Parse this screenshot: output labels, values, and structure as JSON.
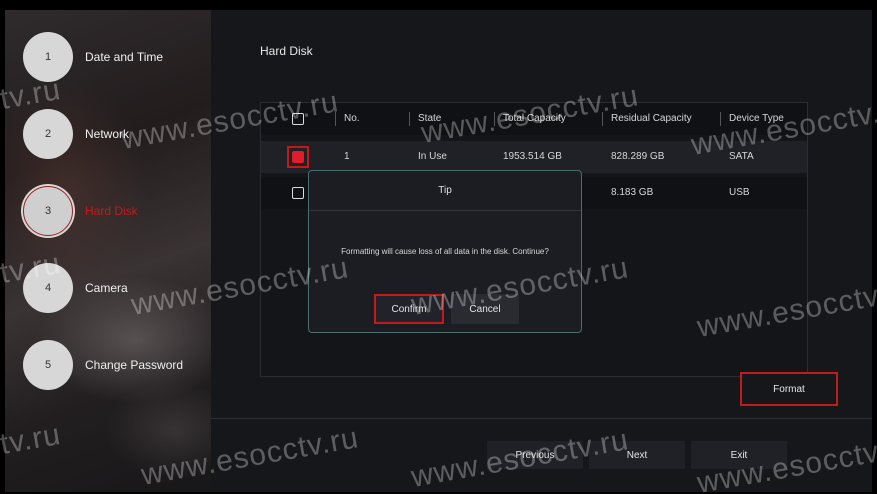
{
  "wizard": {
    "steps": [
      {
        "num": "1",
        "label": "Date and Time"
      },
      {
        "num": "2",
        "label": "Network"
      },
      {
        "num": "3",
        "label": "Hard Disk"
      },
      {
        "num": "4",
        "label": "Camera"
      },
      {
        "num": "5",
        "label": "Change Password"
      }
    ],
    "active_step": 3
  },
  "section_title": "Hard Disk",
  "table": {
    "columns": [
      "No.",
      "State",
      "Total Capacity",
      "Residual Capacity",
      "Device Type"
    ],
    "rows": [
      {
        "no": "1",
        "state": "In Use",
        "total": "1953.514 GB",
        "residual": "828.289 GB",
        "type": "SATA",
        "checked": true
      },
      {
        "no": "",
        "state": "",
        "total": "",
        "residual": "8.183 GB",
        "type": "USB",
        "checked": false
      }
    ]
  },
  "dialog": {
    "title": "Tip",
    "message": "Formatting will cause loss of all data in the disk. Continue?",
    "confirm_label": "Confirm",
    "cancel_label": "Cancel"
  },
  "buttons": {
    "format": "Format",
    "previous": "Previous",
    "next": "Next",
    "exit": "Exit"
  },
  "watermark": {
    "domain": "www.esocctv.ru",
    "fragment": "tv.ru"
  },
  "colors": {
    "accent_red": "#c21b1b",
    "checkbox_red": "#e01d2a",
    "dialog_border": "#4a6d6d",
    "panel_bg": "#16171b"
  }
}
